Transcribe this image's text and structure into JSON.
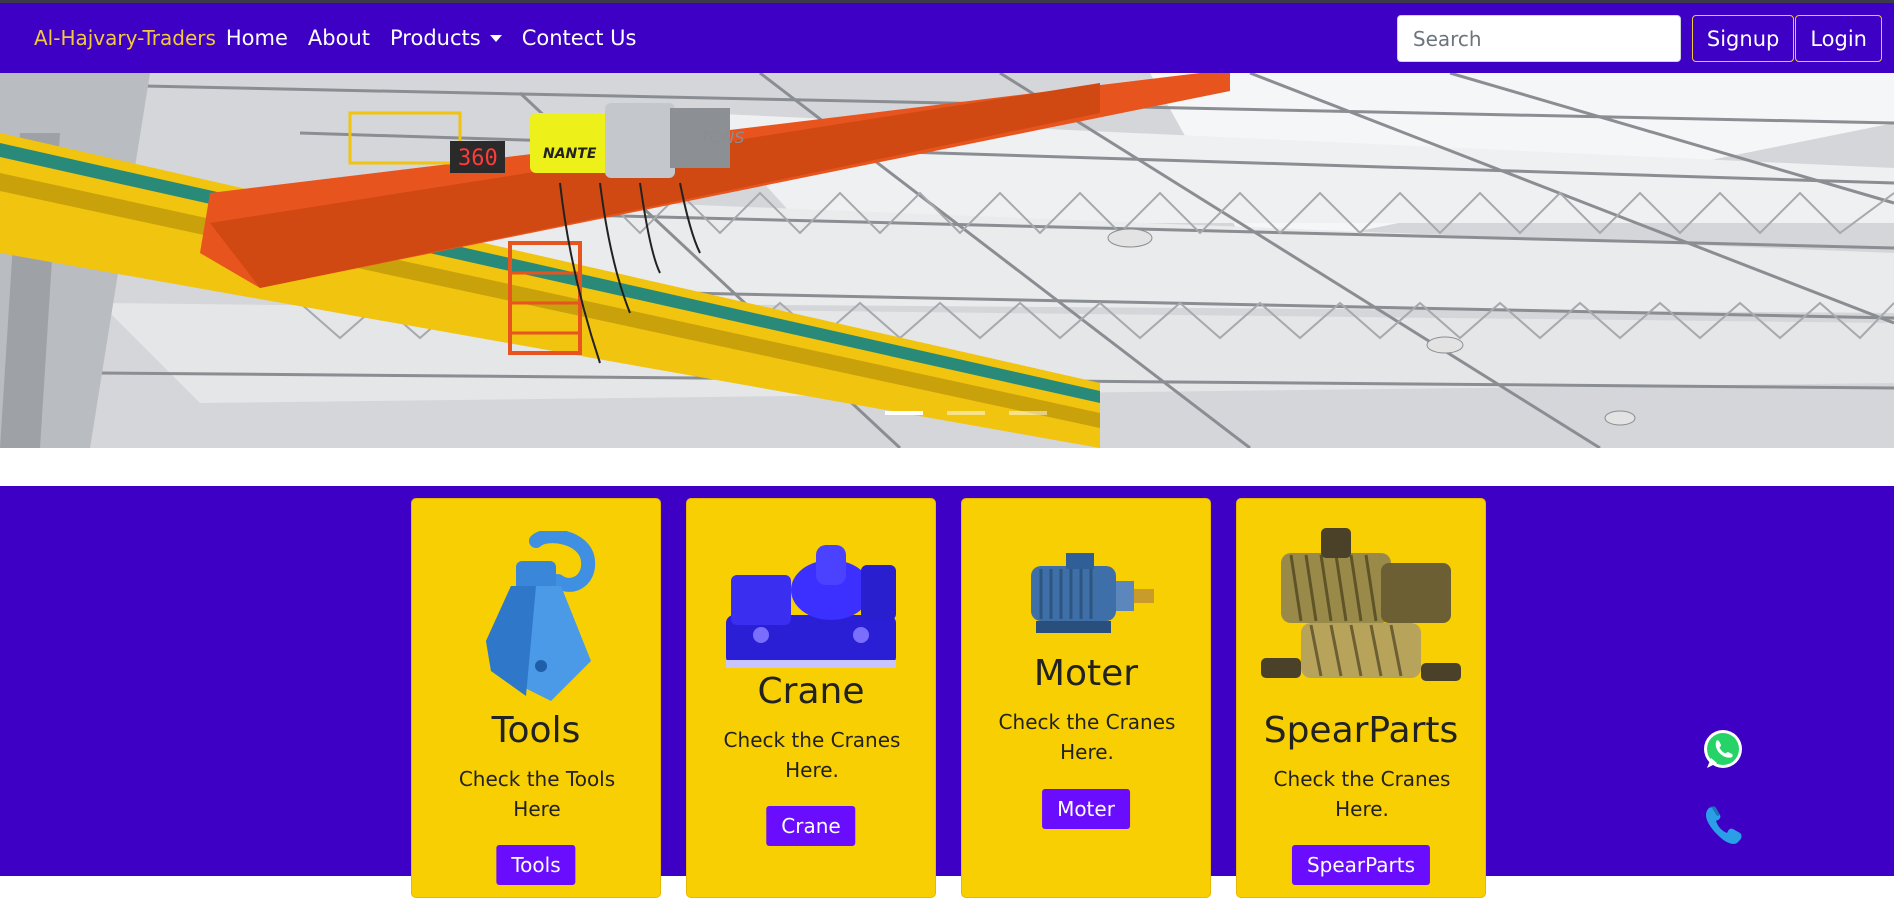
{
  "colors": {
    "nav_bg": "#3d00c4",
    "brand": "#f3c93a",
    "card_bg": "#f8cf02",
    "card_button": "#6a0dff"
  },
  "navbar": {
    "brand": "Al-Hajvary-Traders",
    "links": [
      "Home",
      "About",
      "Products",
      "Contect Us"
    ],
    "search_placeholder": "Search",
    "signup": "Signup",
    "login": "Login"
  },
  "carousel": {
    "image": "overhead-crane-photo",
    "display_text": "360",
    "brand_text": "NANTE",
    "tons_text": "TONS",
    "slides": 3,
    "active_slide": 1
  },
  "cards": [
    {
      "title": "Tools",
      "text": "Check the Tools Here",
      "button": "Tools",
      "image": "crane-hook-image"
    },
    {
      "title": "Crane",
      "text": "Check the Cranes Here.",
      "button": "Crane",
      "image": "crane-winch-image"
    },
    {
      "title": "Moter",
      "text": "Check the Cranes Here.",
      "button": "Moter",
      "image": "electric-motor-image"
    },
    {
      "title": "SpearParts",
      "text": "Check the Cranes Here.",
      "button": "SpearParts",
      "image": "gear-parts-image"
    }
  ],
  "floating": [
    "whatsapp-icon",
    "phone-icon"
  ]
}
